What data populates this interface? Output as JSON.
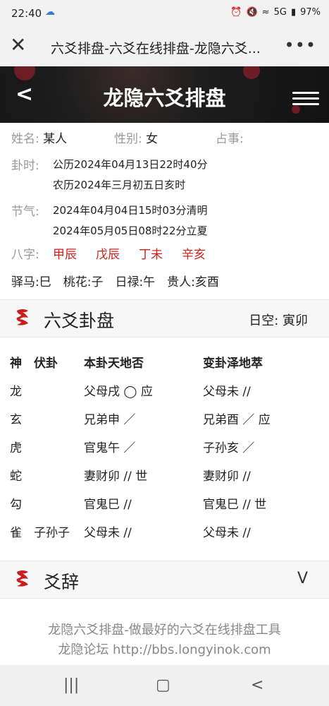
{
  "status": {
    "time": "22:40",
    "battery": "97%",
    "signal": "5G"
  },
  "browser": {
    "title": "六爻排盘-六爻在线排盘-龙隐六爻..."
  },
  "header": {
    "title": "龙隐六爻排盘",
    "back": "<"
  },
  "info": {
    "name_label": "姓名:",
    "name": "某人",
    "gender_label": "性别:",
    "gender": "女",
    "matter_label": "占事:",
    "time_label": "卦时:",
    "time_solar": "公历2024年04月13日22时40分",
    "time_lunar": "农历2024年三月初五日亥时",
    "jieqi_label": "节气:",
    "jieqi_1": "2024年04月04日15时03分清明",
    "jieqi_2": "2024年05月05日08时22分立夏",
    "bazi_label": "八字:",
    "bazi": [
      "甲辰",
      "戊辰",
      "丁未",
      "辛亥"
    ],
    "shensha": "驿马:巳　桃花:子　日禄:午　贵人:亥酉"
  },
  "gua_section": {
    "title": "六爻卦盘",
    "kong": "日空:  寅卯"
  },
  "table": {
    "headers": [
      "神",
      "伏卦",
      "本卦天地否",
      "变卦泽地萃"
    ],
    "rows": [
      [
        "龙",
        "",
        "父母戌 ◯ 应",
        "父母未 //"
      ],
      [
        "玄",
        "",
        "兄弟申 ／",
        "兄弟酉 ／ 应"
      ],
      [
        "虎",
        "",
        "官鬼午 ／",
        "子孙亥 ／"
      ],
      [
        "蛇",
        "",
        "妻财卯 // 世",
        "妻财卯 //"
      ],
      [
        "勾",
        "",
        "官鬼巳 //",
        "官鬼巳 // 世"
      ],
      [
        "雀",
        "子孙子",
        "父母未 //",
        "父母未 //"
      ]
    ]
  },
  "yaoci_section": {
    "title": "爻辞",
    "chevron": "V"
  },
  "footer": {
    "line1": "龙隐六爻排盘-做最好的六爻在线排盘工具",
    "line2": "龙隐论坛 http://bbs.longyinok.com"
  },
  "colors": {
    "accent_red": "#d0201c",
    "header_bg": "#151515"
  }
}
